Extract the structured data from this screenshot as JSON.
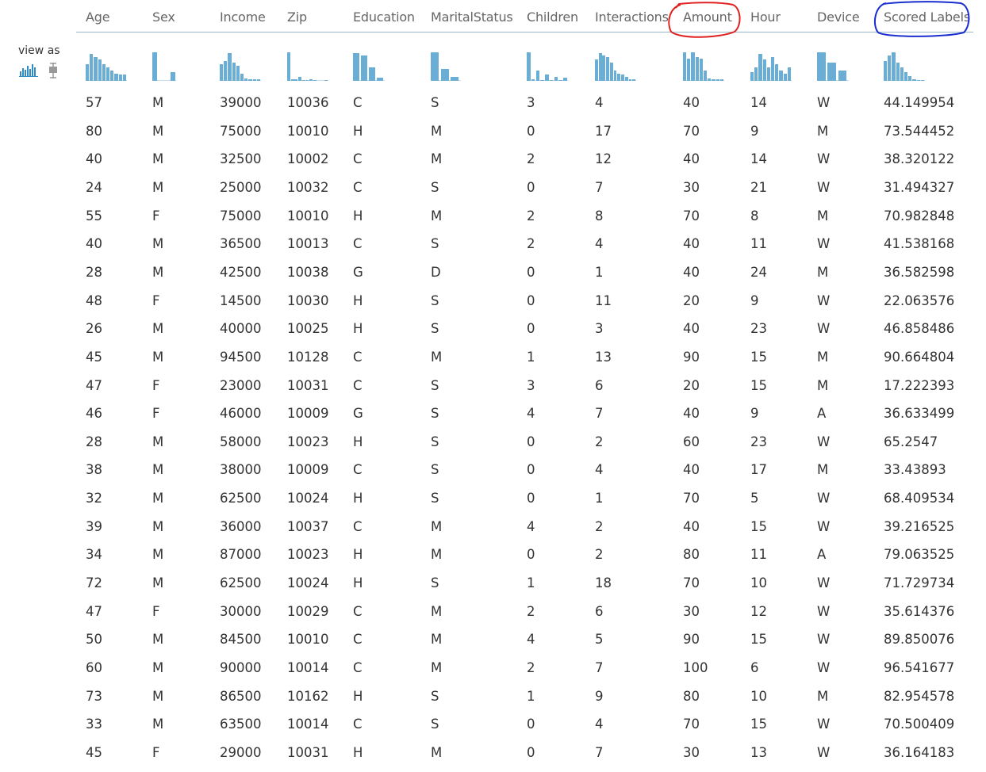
{
  "view_as": {
    "label": "view as",
    "options": [
      "histogram-icon",
      "boxplot-icon"
    ]
  },
  "columns": [
    "Age",
    "Sex",
    "Income",
    "Zip",
    "Education",
    "MaritalStatus",
    "Children",
    "Interactions",
    "Amount",
    "Hour",
    "Device",
    "Scored Labels"
  ],
  "highlighted_columns": [
    {
      "name": "Amount",
      "color": "#e02020"
    },
    {
      "name": "Scored Labels",
      "color": "#1a2ed0"
    }
  ],
  "colors": {
    "histogram": "#6aaed6",
    "header_rule": "#9ab8cc"
  },
  "histograms": [
    [
      0.55,
      0.9,
      0.8,
      0.7,
      0.55,
      0.45,
      0.35,
      0.25,
      0.2,
      0.2
    ],
    [
      0.95,
      0,
      0,
      0.3
    ],
    [
      0.55,
      0.65,
      0.92,
      0.6,
      0.5,
      0.25,
      0.08,
      0.04,
      0.04,
      0.04
    ],
    [
      0.95,
      0.04,
      0.04,
      0.12,
      0.03,
      0.03,
      0.06,
      0.03,
      0,
      0,
      0.03
    ],
    [
      0.92,
      0.85,
      0.45,
      0.1
    ],
    [
      0.95,
      0.4,
      0.12
    ],
    [
      0.95,
      0.04,
      0.35,
      0.03,
      0.22,
      0.03,
      0.12,
      0.03,
      0.1
    ],
    [
      0.7,
      0.92,
      0.85,
      0.8,
      0.6,
      0.35,
      0.25,
      0.2,
      0.12,
      0.06,
      0.04
    ],
    [
      0.95,
      0.75,
      0.95,
      0.8,
      0.75,
      0.35,
      0.08,
      0.04,
      0.04,
      0.04
    ],
    [
      0.3,
      0.45,
      0.9,
      0.7,
      0.45,
      0.8,
      0.55,
      0.35,
      0.25,
      0.45
    ],
    [
      0.95,
      0.6,
      0.35
    ],
    [
      0.65,
      0.85,
      0.95,
      0.6,
      0.45,
      0.3,
      0.15,
      0.06,
      0.03,
      0.03
    ]
  ],
  "rows": [
    [
      "57",
      "M",
      "39000",
      "10036",
      "C",
      "S",
      "3",
      "4",
      "40",
      "14",
      "W",
      "44.149954"
    ],
    [
      "80",
      "M",
      "75000",
      "10010",
      "H",
      "M",
      "0",
      "17",
      "70",
      "9",
      "M",
      "73.544452"
    ],
    [
      "40",
      "M",
      "32500",
      "10002",
      "C",
      "M",
      "2",
      "12",
      "40",
      "14",
      "W",
      "38.320122"
    ],
    [
      "24",
      "M",
      "25000",
      "10032",
      "C",
      "S",
      "0",
      "7",
      "30",
      "21",
      "W",
      "31.494327"
    ],
    [
      "55",
      "F",
      "75000",
      "10010",
      "H",
      "M",
      "2",
      "8",
      "70",
      "8",
      "M",
      "70.982848"
    ],
    [
      "40",
      "M",
      "36500",
      "10013",
      "C",
      "S",
      "2",
      "4",
      "40",
      "11",
      "W",
      "41.538168"
    ],
    [
      "28",
      "M",
      "42500",
      "10038",
      "G",
      "D",
      "0",
      "1",
      "40",
      "24",
      "M",
      "36.582598"
    ],
    [
      "48",
      "F",
      "14500",
      "10030",
      "H",
      "S",
      "0",
      "11",
      "20",
      "9",
      "W",
      "22.063576"
    ],
    [
      "26",
      "M",
      "40000",
      "10025",
      "H",
      "S",
      "0",
      "3",
      "40",
      "23",
      "W",
      "46.858486"
    ],
    [
      "45",
      "M",
      "94500",
      "10128",
      "C",
      "M",
      "1",
      "13",
      "90",
      "15",
      "M",
      "90.664804"
    ],
    [
      "47",
      "F",
      "23000",
      "10031",
      "C",
      "S",
      "3",
      "6",
      "20",
      "15",
      "M",
      "17.222393"
    ],
    [
      "46",
      "F",
      "46000",
      "10009",
      "G",
      "S",
      "4",
      "7",
      "40",
      "9",
      "A",
      "36.633499"
    ],
    [
      "28",
      "M",
      "58000",
      "10023",
      "H",
      "S",
      "0",
      "2",
      "60",
      "23",
      "W",
      "65.2547"
    ],
    [
      "38",
      "M",
      "38000",
      "10009",
      "C",
      "S",
      "0",
      "4",
      "40",
      "17",
      "M",
      "33.43893"
    ],
    [
      "32",
      "M",
      "62500",
      "10024",
      "H",
      "S",
      "0",
      "1",
      "70",
      "5",
      "W",
      "68.409534"
    ],
    [
      "39",
      "M",
      "36000",
      "10037",
      "C",
      "M",
      "4",
      "2",
      "40",
      "15",
      "W",
      "39.216525"
    ],
    [
      "34",
      "M",
      "87000",
      "10023",
      "H",
      "M",
      "0",
      "2",
      "80",
      "11",
      "A",
      "79.063525"
    ],
    [
      "72",
      "M",
      "62500",
      "10024",
      "H",
      "S",
      "1",
      "18",
      "70",
      "10",
      "W",
      "71.729734"
    ],
    [
      "47",
      "F",
      "30000",
      "10029",
      "C",
      "M",
      "2",
      "6",
      "30",
      "12",
      "W",
      "35.614376"
    ],
    [
      "50",
      "M",
      "84500",
      "10010",
      "C",
      "M",
      "4",
      "5",
      "90",
      "15",
      "W",
      "89.850076"
    ],
    [
      "60",
      "M",
      "90000",
      "10014",
      "C",
      "M",
      "2",
      "7",
      "100",
      "6",
      "W",
      "96.541677"
    ],
    [
      "73",
      "M",
      "86500",
      "10162",
      "H",
      "S",
      "1",
      "9",
      "80",
      "10",
      "M",
      "82.954578"
    ],
    [
      "33",
      "M",
      "63500",
      "10014",
      "C",
      "S",
      "0",
      "4",
      "70",
      "15",
      "W",
      "70.500409"
    ],
    [
      "45",
      "F",
      "29000",
      "10031",
      "H",
      "M",
      "0",
      "7",
      "30",
      "13",
      "W",
      "36.164183"
    ]
  ]
}
